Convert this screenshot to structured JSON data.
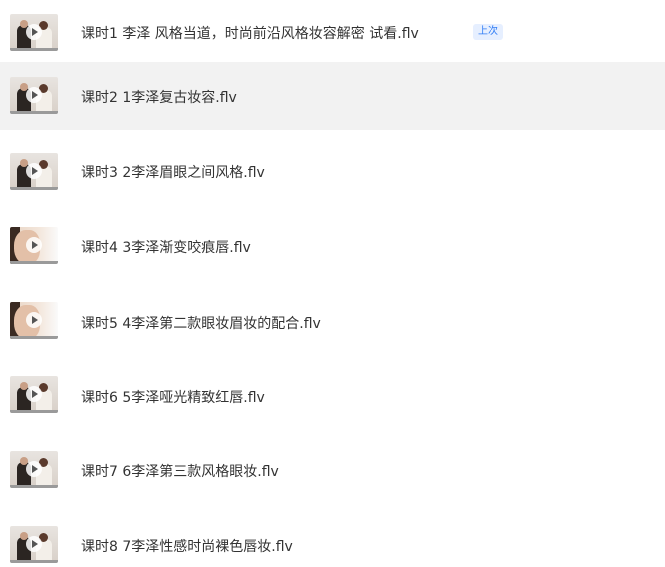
{
  "lessons": [
    {
      "title": "课时1 李泽 风格当道，时尚前沿风格妆容解密 试看.flv",
      "badge": "上次",
      "thumb": "two-people"
    },
    {
      "title": "课时2 1李泽复古妆容.flv",
      "thumb": "two-people"
    },
    {
      "title": "课时3 2李泽眉眼之间风格.flv",
      "thumb": "two-people"
    },
    {
      "title": "课时4 3李泽渐变咬痕唇.flv",
      "thumb": "face"
    },
    {
      "title": "课时5 4李泽第二款眼妆眉妆的配合.flv",
      "thumb": "face"
    },
    {
      "title": "课时6 5李泽哑光精致红唇.flv",
      "thumb": "two-people"
    },
    {
      "title": "课时7 6李泽第三款风格眼妆.flv",
      "thumb": "two-people"
    },
    {
      "title": "课时8 7李泽性感时尚裸色唇妆.flv",
      "thumb": "two-people"
    }
  ]
}
